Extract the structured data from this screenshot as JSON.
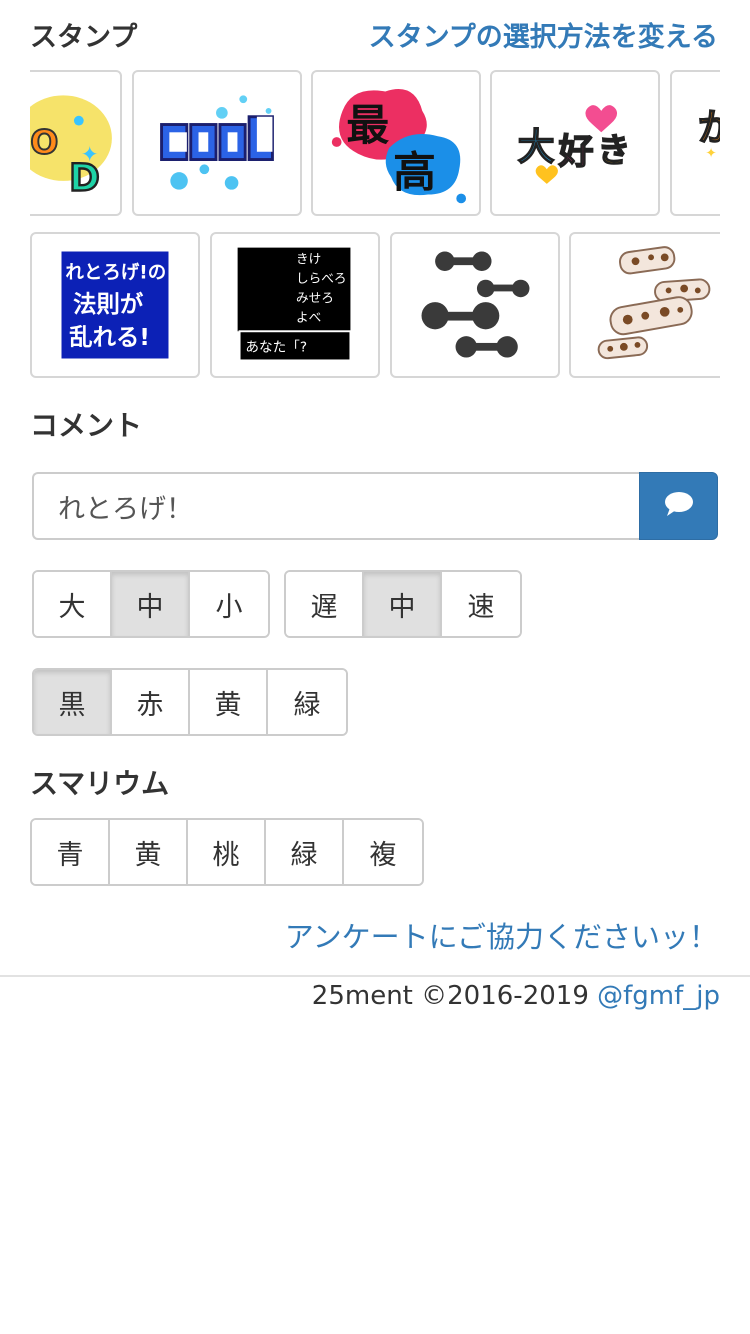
{
  "stamps": {
    "title": "スタンプ",
    "change_link": "スタンプの選択方法を変える",
    "row1": [
      {
        "name": "good-stamp",
        "text": "GOOD"
      },
      {
        "name": "cool-stamp",
        "text": "COOL"
      },
      {
        "name": "saikou-stamp",
        "text": "最高"
      },
      {
        "name": "daisuki-stamp",
        "text": "大好き"
      },
      {
        "name": "partial-stamp",
        "text": "か"
      }
    ],
    "row2": [
      {
        "name": "retorogee-law-stamp",
        "lines": [
          "れとろげ!の",
          "法則が",
          "乱れる!"
        ]
      },
      {
        "name": "rpg-dialog-stamp",
        "lines": [
          "きけ",
          "しらべろ",
          "みせろ",
          "よべ"
        ],
        "prompt": "あなた「?"
      },
      {
        "name": "dumbbell-stamp"
      },
      {
        "name": "macaroni-stamp"
      }
    ]
  },
  "comment": {
    "title": "コメント",
    "value": "れとろげ！",
    "send_icon": "comment-icon"
  },
  "size_options": {
    "items": [
      "大",
      "中",
      "小"
    ],
    "selected": 1
  },
  "speed_options": {
    "items": [
      "遅",
      "中",
      "速"
    ],
    "selected": 1
  },
  "color_options": {
    "items": [
      "黒",
      "赤",
      "黄",
      "緑"
    ],
    "selected": 0
  },
  "smarium": {
    "title": "スマリウム",
    "items": [
      "青",
      "黄",
      "桃",
      "緑",
      "複"
    ]
  },
  "survey_link": "アンケートにご協力くださいッ！",
  "footer": {
    "copyright": "25ment ©2016-2019 ",
    "handle": "@fgmf_jp"
  },
  "colors": {
    "accent": "#337ab7",
    "border": "#cccccc",
    "active_bg": "#e0e0e0"
  }
}
